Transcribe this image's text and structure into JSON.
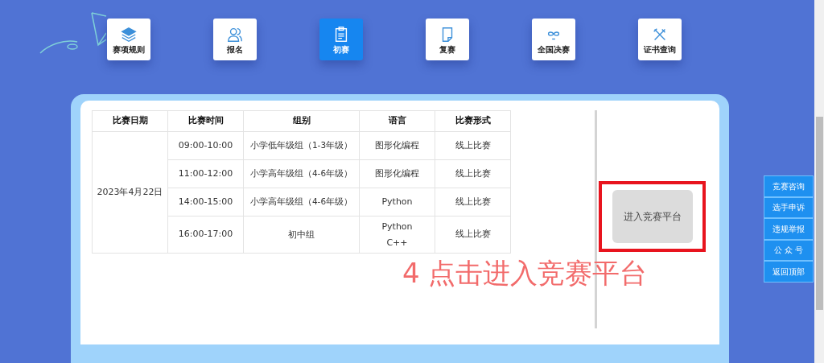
{
  "nav": [
    {
      "label": "赛项规则",
      "selected": false
    },
    {
      "label": "报名",
      "selected": false
    },
    {
      "label": "初赛",
      "selected": true
    },
    {
      "label": "复赛",
      "selected": false
    },
    {
      "label": "全国决赛",
      "selected": false
    },
    {
      "label": "证书查询",
      "selected": false
    }
  ],
  "table": {
    "columns": [
      "比赛日期",
      "比赛时间",
      "组别",
      "语言",
      "比赛形式"
    ],
    "date": "2023年4月22日",
    "rows": [
      {
        "time": "09:00-10:00",
        "group": "小学低年级组（1-3年级）",
        "language": [
          "图形化编程"
        ],
        "format": "线上比赛"
      },
      {
        "time": "11:00-12:00",
        "group": "小学高年级组（4-6年级）",
        "language": [
          "图形化编程"
        ],
        "format": "线上比赛"
      },
      {
        "time": "14:00-15:00",
        "group": "小学高年级组（4-6年级）",
        "language": [
          "Python"
        ],
        "format": "线上比赛"
      },
      {
        "time": "16:00-17:00",
        "group": "初中组",
        "language": [
          "Python",
          "C++"
        ],
        "format": "线上比赛"
      }
    ]
  },
  "enter_button": {
    "label": "进入竞赛平台"
  },
  "annotation": "4 点击进入竞赛平台",
  "side_menu": [
    "竞赛咨询",
    "选手申诉",
    "违规举报",
    "公 众 号",
    "返回顶部"
  ]
}
